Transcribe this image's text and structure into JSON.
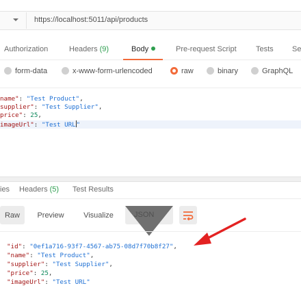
{
  "request": {
    "url": "https://localhost:5011/api/products"
  },
  "request_tabs": [
    {
      "label": "Authorization"
    },
    {
      "label": "Headers",
      "count": "(9)"
    },
    {
      "label": "Body",
      "active": true
    },
    {
      "label": "Pre-request Script"
    },
    {
      "label": "Tests"
    },
    {
      "label": "Se"
    }
  ],
  "body_types": [
    {
      "label": "form-data"
    },
    {
      "label": "x-www-form-urlencoded"
    },
    {
      "label": "raw",
      "selected": true
    },
    {
      "label": "binary"
    },
    {
      "label": "GraphQL"
    }
  ],
  "request_body": {
    "line1_key": "name\"",
    "line1_val": "\"Test Product\"",
    "line2_key": "supplier\"",
    "line2_val": "\"Test Supplier\"",
    "line3_key": "price\"",
    "line3_val": "25",
    "line4_key": "imageUrl\"",
    "line4_val": "\"Test URL"
  },
  "response_tabs": [
    {
      "label": "ies"
    },
    {
      "label": "Headers",
      "count": "(5)"
    },
    {
      "label": "Test Results"
    }
  ],
  "response_toolbar": {
    "raw": "Raw",
    "preview": "Preview",
    "visualize": "Visualize",
    "format": "JSON"
  },
  "response_body": {
    "id_key": "\"id\"",
    "id_val": "\"0ef1a716-93f7-4567-ab75-08d7f70b8f27\"",
    "name_key": "\"name\"",
    "name_val": "\"Test Product\"",
    "supplier_key": "\"supplier\"",
    "supplier_val": "\"Test Supplier\"",
    "price_key": "\"price\"",
    "price_val": "25",
    "image_key": "\"imageUrl\"",
    "image_val": "\"Test URL\""
  },
  "colors": {
    "accent": "#f26b3a",
    "arrow": "#e32222",
    "count_green": "#2e9e4f"
  }
}
